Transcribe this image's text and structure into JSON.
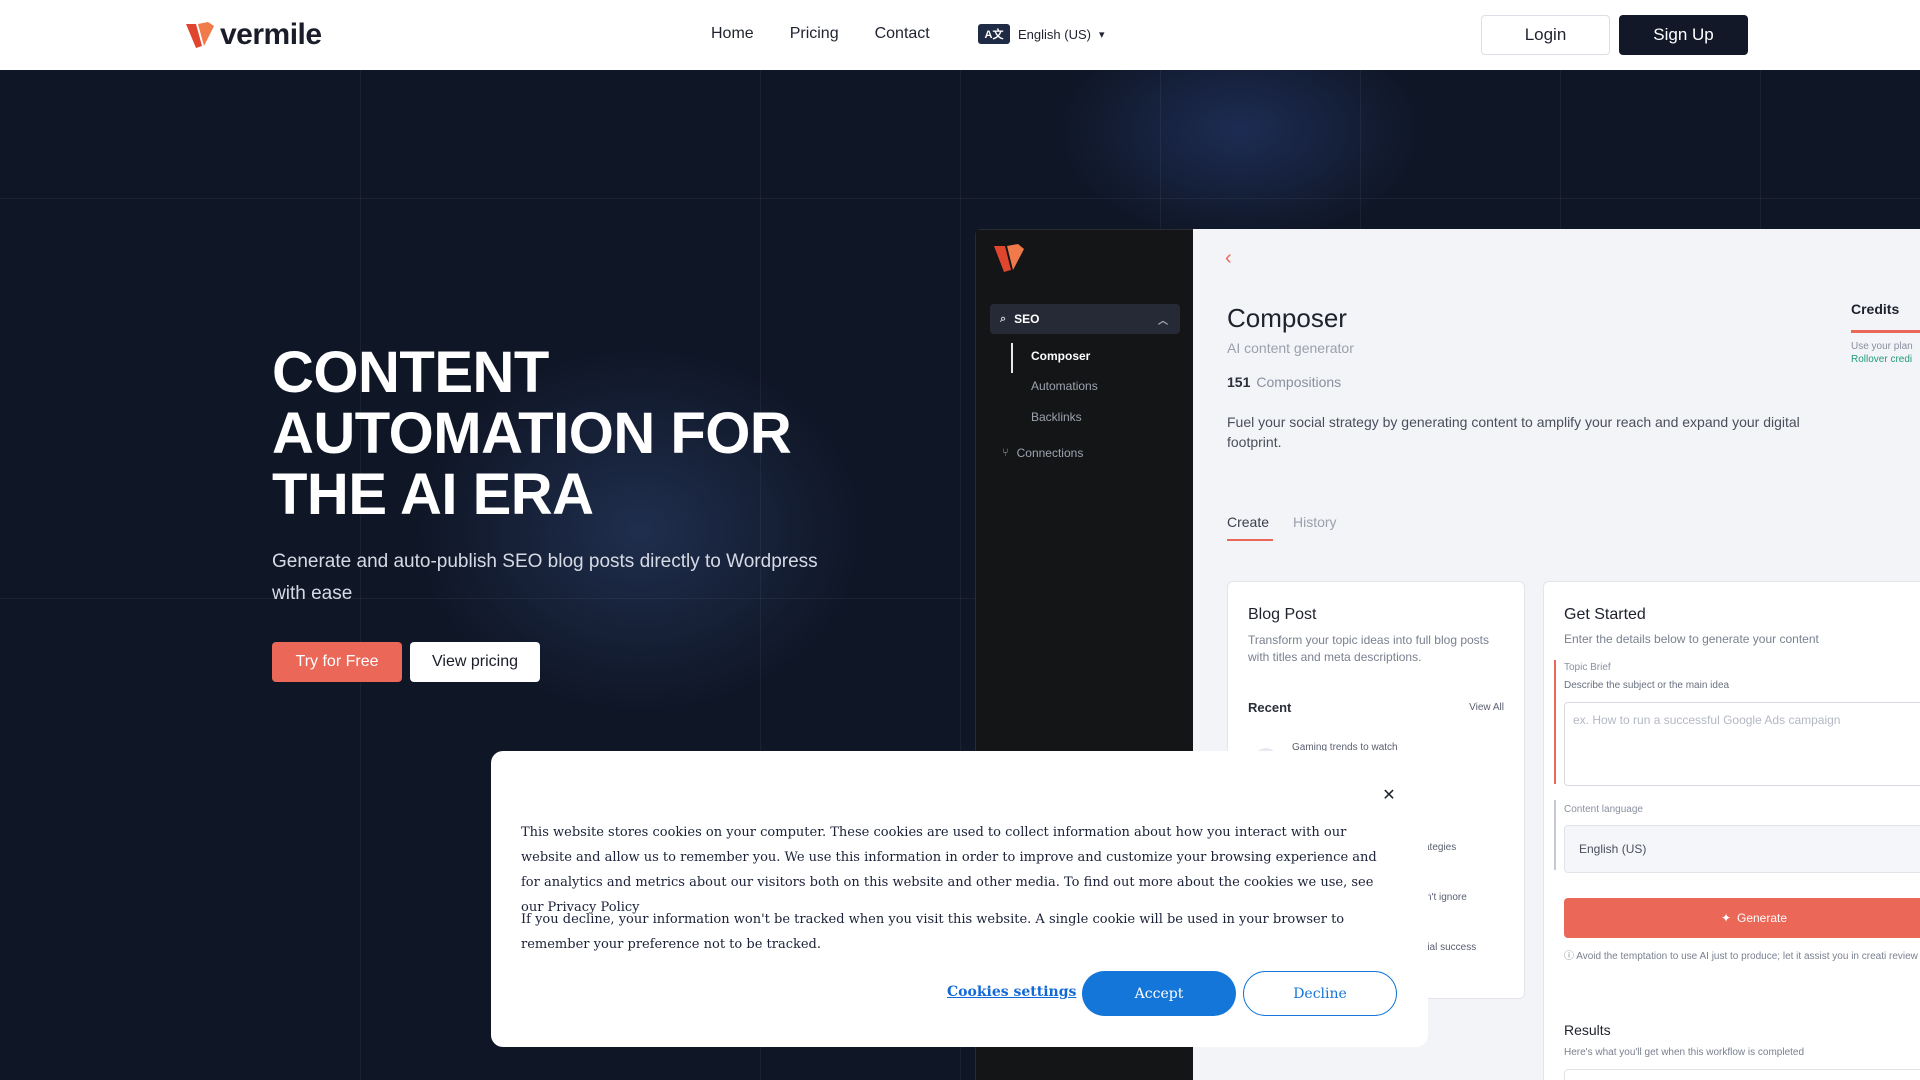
{
  "nav": {
    "brand": "vermile",
    "links": [
      "Home",
      "Pricing",
      "Contact"
    ],
    "language": "English (US)",
    "language_badge": "A文",
    "login": "Login",
    "signup": "Sign Up"
  },
  "hero": {
    "title": "CONTENT AUTOMATION FOR THE AI ERA",
    "subtitle": "Generate and auto-publish SEO blog posts directly to Wordpress with ease",
    "try_button": "Try for Free",
    "pricing_button": "View pricing"
  },
  "app": {
    "sidebar": {
      "section": "SEO",
      "items": [
        "Composer",
        "Automations",
        "Backlinks"
      ],
      "connections": "Connections"
    },
    "main": {
      "title": "Composer",
      "subtitle": "AI content generator",
      "count": "151",
      "count_label": "Compositions",
      "description": "Fuel your social strategy by generating content to amplify your reach and expand your digital footprint.",
      "credits_title": "Credits",
      "credits_note": "Use your plan",
      "credits_rollover": "Rollover credi",
      "tabs": [
        "Create",
        "History"
      ]
    },
    "blog_card": {
      "title": "Blog Post",
      "description": "Transform your topic ideas into full blog posts with titles and meta descriptions.",
      "recent": "Recent",
      "view_all": "View All",
      "recent_items": [
        "Gaming trends to watch",
        "ategies",
        "n't ignore",
        "rial success"
      ]
    },
    "get_started": {
      "title": "Get Started",
      "description": "Enter the details below to generate your content",
      "topic_label": "Topic Brief",
      "topic_hint": "Describe the subject or the main idea",
      "topic_placeholder": "ex. How to run a successful Google Ads campaign",
      "language_label": "Content language",
      "language_value": "English (US)",
      "generate": "Generate",
      "warning": "Avoid the temptation to use AI just to produce; let it assist you in creati review the generated content for inaccuracies and modify it to your liking t",
      "results_title": "Results",
      "results_sub": "Here's what you'll get when this workflow is completed"
    }
  },
  "cookie": {
    "text1": "This website stores cookies on your computer. These cookies are used to collect information about how you interact with our website and allow us to remember you. We use this information in order to improve and customize your browsing experience and for analytics and metrics about our visitors both on this website and other media. To find out more about the cookies we use, see our Privacy Policy",
    "text2": "If you decline, your information won't be tracked when you visit this website. A single cookie will be used in your browser to remember your preference not to be tracked.",
    "settings": "Cookies settings",
    "accept": "Accept",
    "decline": "Decline"
  },
  "colors": {
    "accent": "#eb6757",
    "dark": "#131829",
    "cookie_blue": "#1576d9"
  }
}
